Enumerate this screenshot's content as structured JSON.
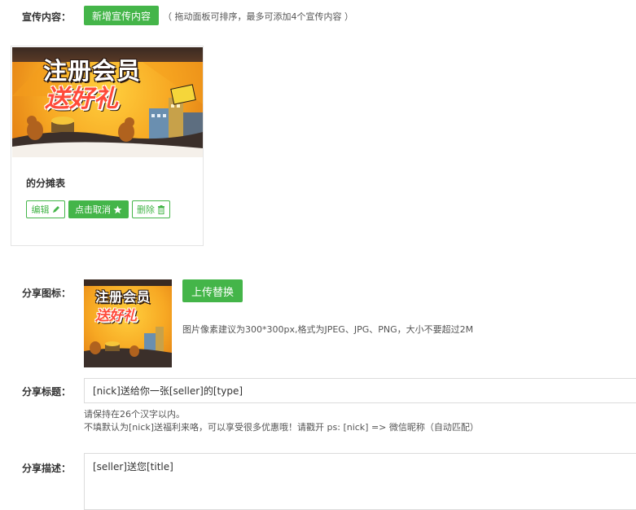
{
  "promo": {
    "label": "宣传内容：",
    "add_button": "新增宣传内容",
    "hint": "（ 拖动面板可排序，最多可添加4个宣传内容 ）"
  },
  "card": {
    "banner_line1": "注册会员",
    "banner_line2": "送好礼",
    "title": "的分摊表",
    "actions": {
      "edit": "编辑",
      "cancel": "点击取消",
      "delete": "删除"
    }
  },
  "share_icon": {
    "label": "分享图标：",
    "upload_button": "上传替换",
    "hint": "图片像素建议为300*300px,格式为JPEG、JPG、PNG，大小不要超过2M",
    "thumb_line1": "注册会员",
    "thumb_line2": "送好礼"
  },
  "share_title": {
    "label": "分享标题：",
    "value": "[nick]送给你一张[seller]的[type]",
    "note_line1": "请保持在26个汉字以内。",
    "note_line2": "不填默认为[nick]送福利来咯，可以享受很多优惠哦！请戳开 ps: [nick] => 微信昵称（自动匹配）"
  },
  "share_desc": {
    "label": "分享描述：",
    "value": "[seller]送您[title]"
  },
  "colors": {
    "accent": "#44b549",
    "border": "#dcdcdc"
  }
}
